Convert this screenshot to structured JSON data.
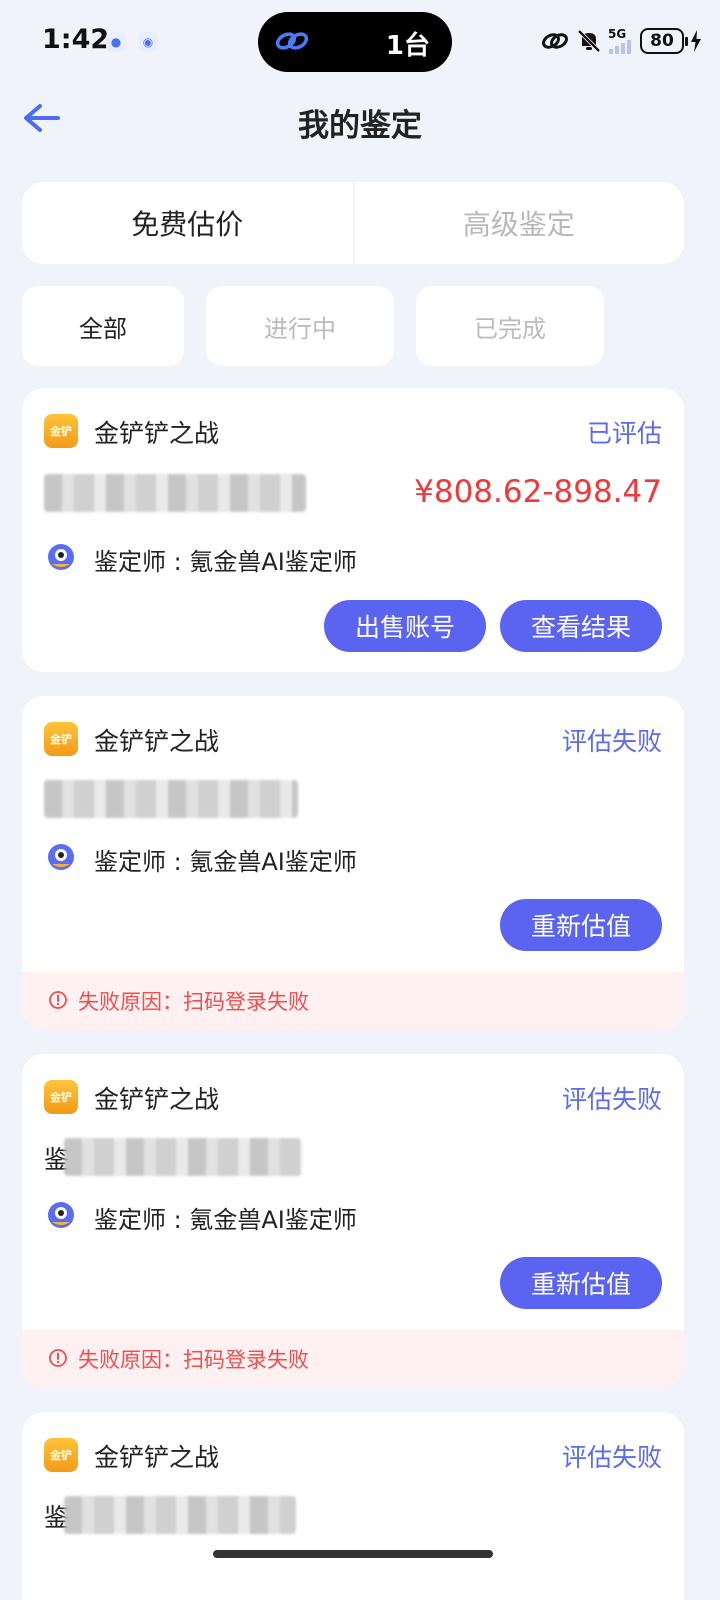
{
  "status_bar": {
    "time": "1:42",
    "island_text": "1台",
    "network": "5G",
    "battery": "80"
  },
  "header": {
    "title": "我的鉴定"
  },
  "main_tabs": [
    {
      "label": "免费估价",
      "active": true
    },
    {
      "label": "高级鉴定",
      "active": false
    }
  ],
  "filters": [
    {
      "label": "全部",
      "active": true
    },
    {
      "label": "进行中",
      "active": false
    },
    {
      "label": "已完成",
      "active": false
    }
  ],
  "cards": [
    {
      "game_icon_text": "金铲",
      "game": "金铲铲之战",
      "status": "已评估",
      "price": "¥808.62-898.47",
      "appraiser": "鉴定师 : 氪金兽AI鉴定师",
      "buttons": [
        "出售账号",
        "查看结果"
      ]
    },
    {
      "game_icon_text": "金铲",
      "game": "金铲铲之战",
      "status": "评估失败",
      "appraiser": "鉴定师 : 氪金兽AI鉴定师",
      "buttons": [
        "重新估值"
      ],
      "fail_reason": "失败原因：扫码登录失败"
    },
    {
      "game_icon_text": "金铲",
      "game": "金铲铲之战",
      "status": "评估失败",
      "account_prefix": "鉴",
      "appraiser": "鉴定师 : 氪金兽AI鉴定师",
      "buttons": [
        "重新估值"
      ],
      "fail_reason": "失败原因：扫码登录失败"
    },
    {
      "game_icon_text": "金铲",
      "game": "金铲铲之战",
      "status": "评估失败",
      "account_prefix": "鉴"
    }
  ],
  "colors": {
    "accent": "#5a64f0",
    "price": "#f0383a",
    "fail_text": "#ee4f4f",
    "fail_bg": "#fff1f1",
    "background": "#f0f3fa"
  }
}
